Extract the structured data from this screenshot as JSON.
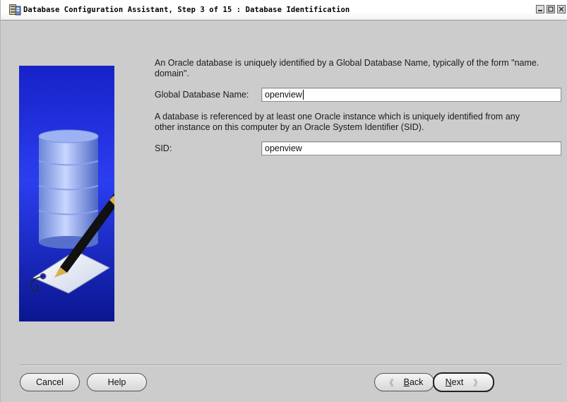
{
  "window": {
    "title": "Database Configuration Assistant, Step 3 of 15 : Database Identification",
    "controls": [
      "minimize",
      "maximize",
      "close"
    ]
  },
  "content": {
    "intro_text": "An Oracle database is uniquely identified by a Global Database Name, typically of the form \"name.",
    "intro_text_cont": "domain\".",
    "global_db_label": "Global Database Name:",
    "global_db_value": "openview",
    "sid_intro_text": "A database is referenced by at least one Oracle instance which is uniquely identified from any",
    "sid_intro_text_cont": "other instance on this computer by an Oracle System Identifier (SID).",
    "sid_label": "SID:",
    "sid_value": "openview"
  },
  "buttons": {
    "cancel": "Cancel",
    "help": "Help",
    "back_mnemonic": "B",
    "back_rest": "ack",
    "next_mnemonic": "N",
    "next_rest": "ext"
  },
  "icons": {
    "app": "dbca-app-icon",
    "illustration": "database-cylinder-pen-tag-illustration"
  },
  "colors": {
    "background": "#cccccc",
    "panel_blue": "#1a2bd6",
    "titlebar": "#ffffff"
  }
}
